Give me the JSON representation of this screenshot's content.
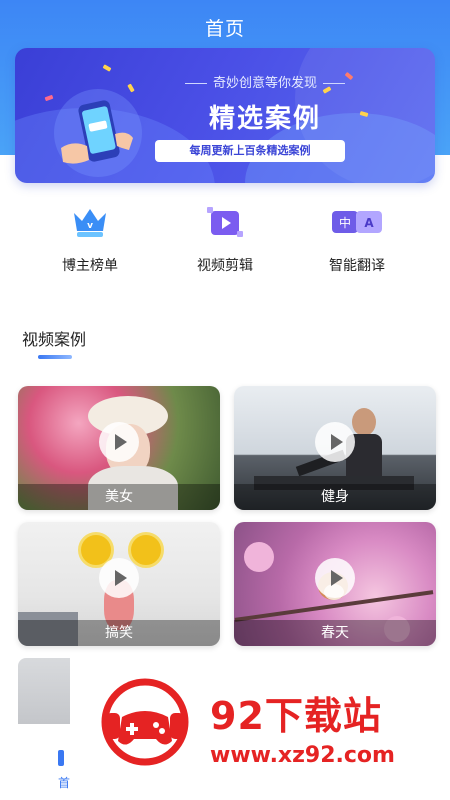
{
  "header": {
    "title": "首页"
  },
  "banner": {
    "tagline": "奇妙创意等你发现",
    "headline": "精选案例",
    "subtitle": "每周更新上百条精选案例"
  },
  "quick_actions": [
    {
      "label": "博主榜单",
      "icon": "crown-icon"
    },
    {
      "label": "视频剪辑",
      "icon": "video-edit-icon"
    },
    {
      "label": "智能翻译",
      "icon": "translate-icon"
    }
  ],
  "section": {
    "title": "视频案例"
  },
  "cases": [
    {
      "caption": "美女"
    },
    {
      "caption": "健身"
    },
    {
      "caption": "搞笑"
    },
    {
      "caption": "春天"
    }
  ],
  "bottom_nav": {
    "home_label": "首"
  },
  "watermark": {
    "title": "92下载站",
    "url": "www.xz92.com"
  },
  "colors": {
    "accent": "#3a78f2",
    "banner": "#4046dd",
    "watermark": "#e52323"
  }
}
